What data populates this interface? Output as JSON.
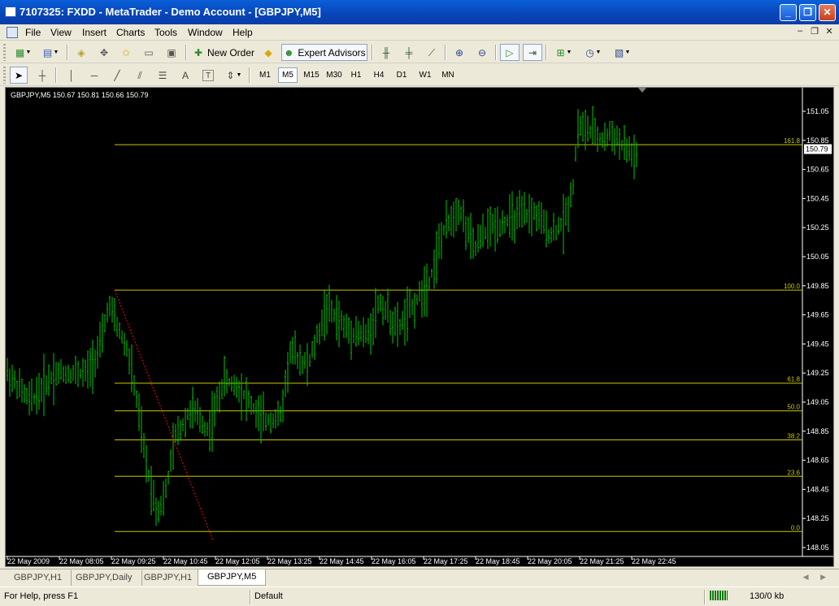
{
  "window": {
    "title": "7107325: FXDD - MetaTrader - Demo Account - [GBPJPY,M5]",
    "minimize_glyph": "_",
    "maximize_glyph": "❐",
    "close_glyph": "✕"
  },
  "menu": {
    "items": [
      "File",
      "View",
      "Insert",
      "Charts",
      "Tools",
      "Window",
      "Help"
    ],
    "mdi_minimize": "–",
    "mdi_restore": "❐",
    "mdi_close": "✕"
  },
  "toolbar1": {
    "new_order": "New Order",
    "expert_advisors": "Expert Advisors"
  },
  "toolbar2": {
    "timeframes": [
      "M1",
      "M5",
      "M15",
      "M30",
      "H1",
      "H4",
      "D1",
      "W1",
      "MN"
    ],
    "active_timeframe": "M5",
    "text_tool": "A",
    "label_tool": "T"
  },
  "chart": {
    "header": "GBPJPY,M5  150.67 150.81 150.66 150.79",
    "current_price": "150.79",
    "price_axis": [
      "151.05",
      "150.85",
      "150.65",
      "150.45",
      "150.25",
      "150.05",
      "149.85",
      "149.65",
      "149.45",
      "149.25",
      "149.05",
      "148.85",
      "148.65",
      "148.45",
      "148.25",
      "148.05"
    ],
    "time_axis": [
      "22 May 2009",
      "22 May 08:05",
      "22 May 09:25",
      "22 May 10:45",
      "22 May 12:05",
      "22 May 13:25",
      "22 May 14:45",
      "22 May 16:05",
      "22 May 17:25",
      "22 May 18:45",
      "22 May 20:05",
      "22 May 21:25",
      "22 May 22:45"
    ],
    "fib_levels": [
      {
        "label": "161.8",
        "price": 150.82
      },
      {
        "label": "100.0",
        "price": 149.82
      },
      {
        "label": "61.8",
        "price": 149.18
      },
      {
        "label": "50.0",
        "price": 148.99
      },
      {
        "label": "38.2",
        "price": 148.79
      },
      {
        "label": "23.6",
        "price": 148.54
      },
      {
        "label": "0.0",
        "price": 148.16
      }
    ],
    "colors": {
      "background": "#000000",
      "bars": "#00c800",
      "fib": "#c8c800",
      "trendline": "#ff0000",
      "text": "#ffffff"
    }
  },
  "tabs": [
    "GBPJPY,H1",
    "GBPJPY,Daily",
    "GBPJPY,H1",
    "GBPJPY,M5"
  ],
  "active_tab": "GBPJPY,M5",
  "tab_nav": "◀ ▶",
  "status": {
    "help": "For Help, press F1",
    "profile": "Default",
    "traffic": "130/0 kb"
  }
}
